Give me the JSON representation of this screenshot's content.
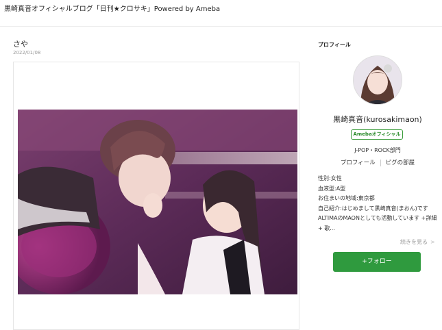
{
  "header": {
    "site_title": "黒崎真音オフィシャルブログ「日刊★クロサキ」Powered by Ameba"
  },
  "post": {
    "title": "さや",
    "date": "2022/01/08"
  },
  "profile": {
    "heading": "プロフィール",
    "name": "黒崎真音(kurosakimaon)",
    "badge": "Amebaオフィシャル",
    "genre": "J-POP・ROCK部門",
    "links": [
      "プロフィール",
      "ピグの部屋"
    ],
    "gender": "性別:女性",
    "blood": "血液型:A型",
    "residence": "お住まいの地域:東京都",
    "intro": "自己紹介:はじめまして黒崎真音(まおん)です ALTIMAのMAONとしても活動しています +詳細+ 歌...",
    "more_label": "続きを見る",
    "follow_label": "+フォロー"
  },
  "icons": {
    "more": "chevron-right-icon"
  },
  "colors": {
    "follow_bg": "#2f9a3e",
    "badge_green": "#2a8a2a"
  }
}
